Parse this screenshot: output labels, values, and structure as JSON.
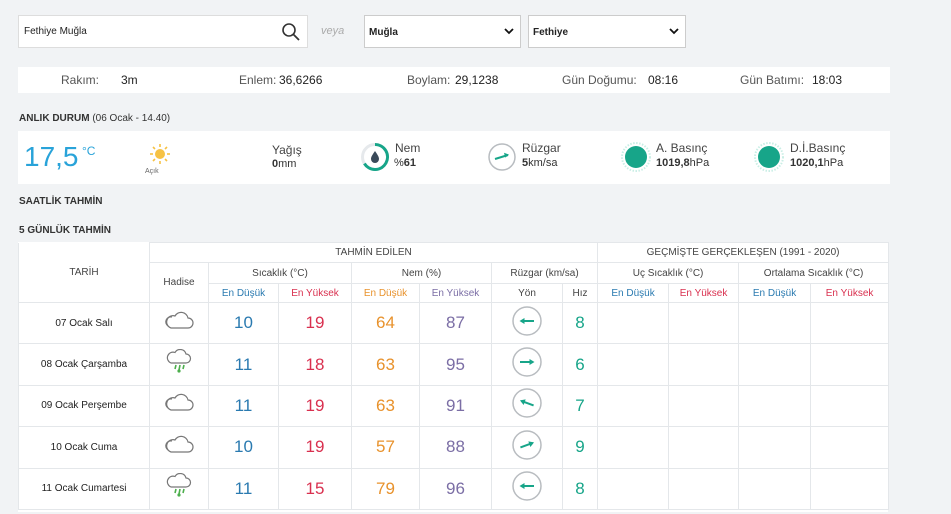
{
  "search": {
    "value": "Fethiye Muğla",
    "placeholder": ""
  },
  "veya_label": "veya",
  "province_select": {
    "selected": "Muğla"
  },
  "district_select": {
    "selected": "Fethiye"
  },
  "info": {
    "rakim_label": "Rakım:",
    "rakim_value": "3m",
    "enlem_label": "Enlem:",
    "enlem_value": "36,6266",
    "boylam_label": "Boylam:",
    "boylam_value": "29,1238",
    "gundogumu_label": "Gün Doğumu:",
    "gundogumu_value": "08:16",
    "gunbatimi_label": "Gün Batımı:",
    "gunbatimi_value": "18:03"
  },
  "now": {
    "title": "ANLIK DURUM",
    "subtitle": "(06 Ocak - 14.40)",
    "temp": "17,5",
    "temp_unit": "°C",
    "condition": "Açık",
    "yagis_label": "Yağış",
    "yagis_value": "0",
    "yagis_unit": "mm",
    "nem_label": "Nem",
    "nem_value": "61",
    "nem_prefix": "%",
    "ruzgar_label": "Rüzgar",
    "ruzgar_value": "5",
    "ruzgar_unit": "km/sa",
    "abasinc_label": "A. Basınç",
    "abasinc_value": "1019,8",
    "abasinc_unit": "hPa",
    "dibasinc_label": "D.İ.Basınç",
    "dibasinc_value": "1020,1",
    "dibasinc_unit": "hPa"
  },
  "hourly_title": "SAATLİK TAHMİN",
  "daily_title": "5 GÜNLÜK TAHMİN",
  "table": {
    "h_tahmin": "TAHMİN EDİLEN",
    "h_gecmis": "GEÇMİŞTE GERÇEKLEŞEN (1991 - 2020)",
    "h_tarih": "TARİH",
    "h_hadise": "Hadise",
    "h_sicaklik": "Sıcaklık (°C)",
    "h_nem": "Nem (%)",
    "h_ruzgar": "Rüzgar (km/sa)",
    "h_uc": "Uç Sıcaklık (°C)",
    "h_ortalama": "Ortalama Sıcaklık (°C)",
    "h_en_dusuk": "En Düşük",
    "h_en_yuksek": "En Yüksek",
    "h_yon": "Yön",
    "h_hiz": "Hız",
    "rows": [
      {
        "date": "07 Ocak Salı",
        "icon": "cloud-icon",
        "t_low": "10",
        "t_high": "19",
        "n_low": "64",
        "n_high": "87",
        "wind_dir": "left",
        "speed": "8"
      },
      {
        "date": "08 Ocak Çarşamba",
        "icon": "rain-cloud-icon",
        "t_low": "11",
        "t_high": "18",
        "n_low": "63",
        "n_high": "95",
        "wind_dir": "right",
        "speed": "6"
      },
      {
        "date": "09 Ocak Perşembe",
        "icon": "cloud-icon",
        "t_low": "11",
        "t_high": "19",
        "n_low": "63",
        "n_high": "91",
        "wind_dir": "upleft",
        "speed": "7"
      },
      {
        "date": "10 Ocak Cuma",
        "icon": "cloud-icon",
        "t_low": "10",
        "t_high": "19",
        "n_low": "57",
        "n_high": "88",
        "wind_dir": "upright",
        "speed": "9"
      },
      {
        "date": "11 Ocak Cumartesi",
        "icon": "rain-cloud-icon",
        "t_low": "11",
        "t_high": "15",
        "n_low": "79",
        "n_high": "96",
        "wind_dir": "left",
        "speed": "8"
      }
    ]
  },
  "colors": {
    "accent": "#29a3d9",
    "teal": "#17a589",
    "low": "#2a7ab0",
    "high": "#d9304f",
    "nem_low": "#e8922c",
    "nem_high": "#7b6ea5"
  }
}
